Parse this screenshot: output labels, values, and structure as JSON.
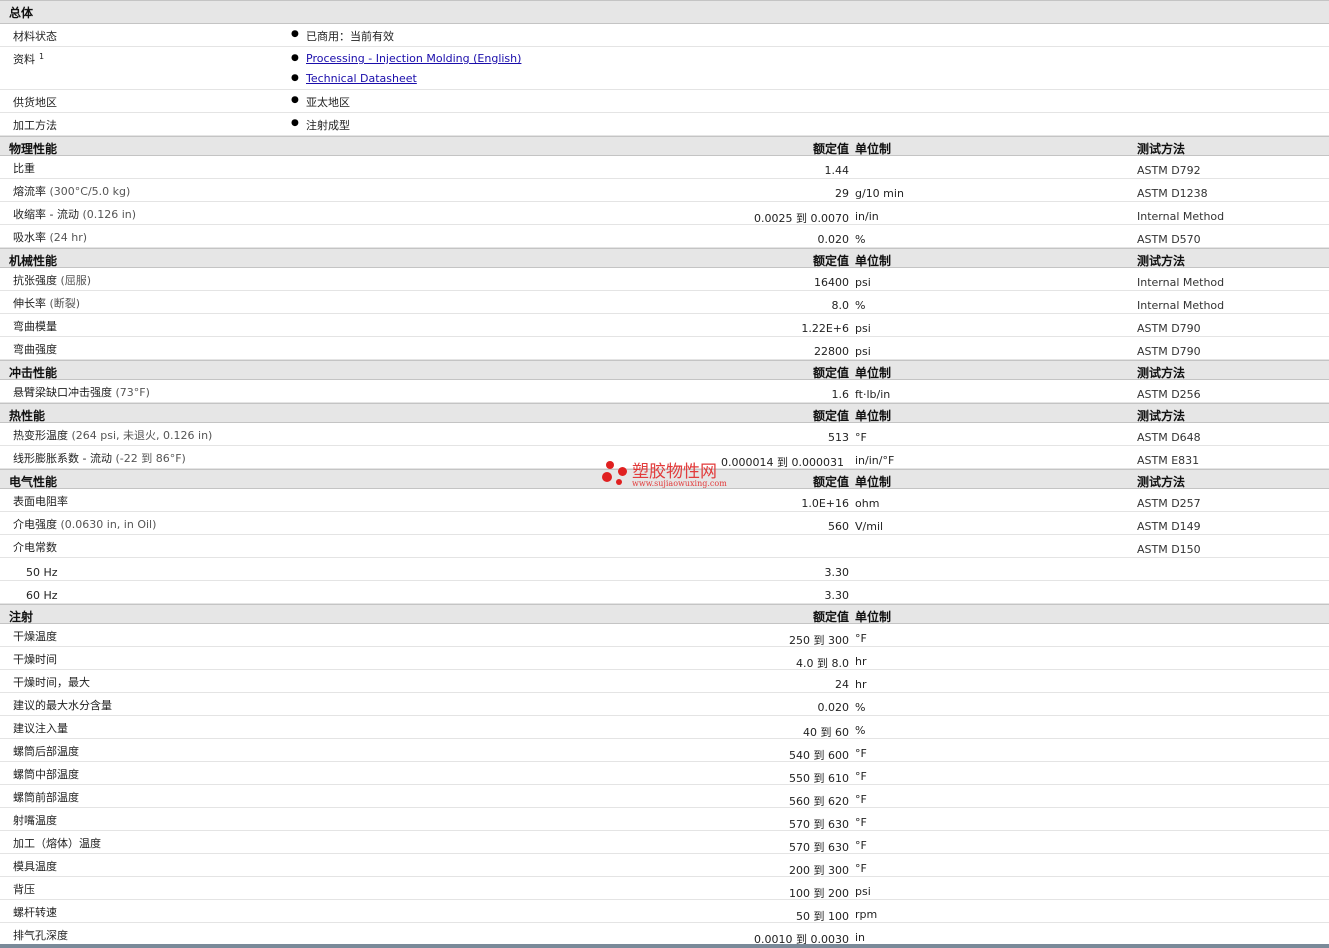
{
  "general": {
    "title": "总体",
    "status_label": "材料状态",
    "status_value": "已商用：当前有效",
    "docs_label": "资料",
    "docs_sup": "1",
    "doc_link_1": "Processing - Injection Molding (English)",
    "doc_link_2": "Technical Datasheet",
    "region_label": "供货地区",
    "region_value": "亚太地区",
    "method_label": "加工方法",
    "method_value": "注射成型"
  },
  "headers": {
    "nominal": "额定值",
    "unit": "单位制",
    "test": "测试方法"
  },
  "physical": {
    "title": "物理性能",
    "rows": [
      {
        "label": "比重",
        "cond": "",
        "value": "1.44",
        "unit": "",
        "test": "ASTM D792"
      },
      {
        "label": "熔流率",
        "cond": "(300°C/5.0 kg)",
        "value": "29",
        "unit": "g/10 min",
        "test": "ASTM D1238"
      },
      {
        "label": "收缩率 - 流动",
        "cond": "(0.126 in)",
        "value": "0.0025 到 0.0070",
        "unit": "in/in",
        "test": "Internal Method"
      },
      {
        "label": "吸水率",
        "cond": "(24 hr)",
        "value": "0.020",
        "unit": "%",
        "test": "ASTM D570"
      }
    ]
  },
  "mechanical": {
    "title": "机械性能",
    "rows": [
      {
        "label": "抗张强度",
        "cond": "(屈服)",
        "value": "16400",
        "unit": "psi",
        "test": "Internal Method"
      },
      {
        "label": "伸长率",
        "cond": "(断裂)",
        "value": "8.0",
        "unit": "%",
        "test": "Internal Method"
      },
      {
        "label": "弯曲模量",
        "cond": "",
        "value": "1.22E+6",
        "unit": "psi",
        "test": "ASTM D790"
      },
      {
        "label": "弯曲强度",
        "cond": "",
        "value": "22800",
        "unit": "psi",
        "test": "ASTM D790"
      }
    ]
  },
  "impact": {
    "title": "冲击性能",
    "rows": [
      {
        "label": "悬臂梁缺口冲击强度",
        "cond": "(73°F)",
        "value": "1.6",
        "unit": "ft·lb/in",
        "test": "ASTM D256"
      }
    ]
  },
  "thermal": {
    "title": "热性能",
    "rows": [
      {
        "label": "热变形温度",
        "cond": "(264 psi, 未退火, 0.126 in)",
        "value": "513",
        "unit": "°F",
        "test": "ASTM D648"
      },
      {
        "label": "线形膨胀系数 - 流动",
        "cond": "(-22 到 86°F)",
        "value": "0.000014 到 0.000031",
        "unit": "in/in/°F",
        "test": "ASTM E831"
      }
    ]
  },
  "electrical": {
    "title": "电气性能",
    "rows": [
      {
        "label": "表面电阻率",
        "cond": "",
        "value": "1.0E+16",
        "unit": "ohm",
        "test": "ASTM D257"
      },
      {
        "label": "介电强度",
        "cond": "(0.0630 in, in Oil)",
        "value": "560",
        "unit": "V/mil",
        "test": "ASTM D149"
      },
      {
        "label": "介电常数",
        "cond": "",
        "value": "",
        "unit": "",
        "test": "ASTM D150"
      },
      {
        "label": "50 Hz",
        "cond": "",
        "value": "3.30",
        "unit": "",
        "test": ""
      },
      {
        "label": "60 Hz",
        "cond": "",
        "value": "3.30",
        "unit": "",
        "test": ""
      }
    ]
  },
  "injection": {
    "title": "注射",
    "rows": [
      {
        "label": "干燥温度",
        "value": "250 到 300",
        "unit": "°F"
      },
      {
        "label": "干燥时间",
        "value": "4.0 到 8.0",
        "unit": "hr"
      },
      {
        "label": "干燥时间，最大",
        "value": "24",
        "unit": "hr"
      },
      {
        "label": "建议的最大水分含量",
        "value": "0.020",
        "unit": "%"
      },
      {
        "label": "建议注入量",
        "value": "40 到 60",
        "unit": "%"
      },
      {
        "label": "螺筒后部温度",
        "value": "540 到 600",
        "unit": "°F"
      },
      {
        "label": "螺筒中部温度",
        "value": "550 到 610",
        "unit": "°F"
      },
      {
        "label": "螺筒前部温度",
        "value": "560 到 620",
        "unit": "°F"
      },
      {
        "label": "射嘴温度",
        "value": "570 到 630",
        "unit": "°F"
      },
      {
        "label": "加工（熔体）温度",
        "value": "570 到 630",
        "unit": "°F"
      },
      {
        "label": "模具温度",
        "value": "200 到 300",
        "unit": "°F"
      },
      {
        "label": "背压",
        "value": "100 到 200",
        "unit": "psi"
      },
      {
        "label": "螺杆转速",
        "value": "50 到 100",
        "unit": "rpm"
      },
      {
        "label": "排气孔深度",
        "value": "0.0010 到 0.0030",
        "unit": "in"
      }
    ]
  },
  "watermark": {
    "name": "塑胶物性网",
    "url": "www.sujiaowuxing.com"
  },
  "colors": {
    "section_bg": "#e6e6e6",
    "link": "#1a0dab",
    "watermark": "#e23b3b",
    "footer": "#7a8a99"
  }
}
